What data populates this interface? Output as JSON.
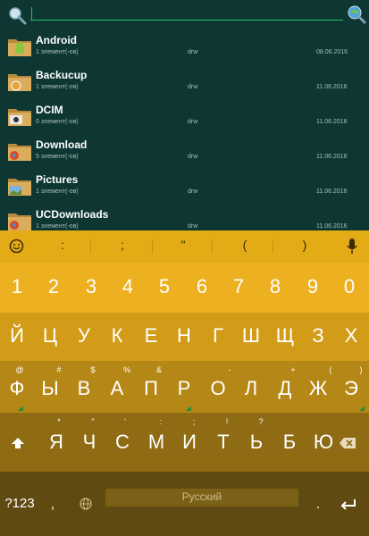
{
  "files": [
    {
      "name": "Android",
      "count": "1 элемент(-ов)",
      "perm": "drw",
      "date": "08.06.2016"
    },
    {
      "name": "Backucup",
      "count": "1 элемент(-ов)",
      "perm": "drw",
      "date": "11.06.2016"
    },
    {
      "name": "DCIM",
      "count": "0 элемент(-ов)",
      "perm": "drw",
      "date": "11.06.2016"
    },
    {
      "name": "Download",
      "count": "5 элемент(-ов)",
      "perm": "drw",
      "date": "11.06.2016"
    },
    {
      "name": "Pictures",
      "count": "1 элемент(-ов)",
      "perm": "drw",
      "date": "11.06.2016"
    },
    {
      "name": "UCDownloads",
      "count": "1 элемент(-ов)",
      "perm": "drw",
      "date": "11.06.2016"
    }
  ],
  "suggestions": [
    ":",
    ";",
    "\"",
    "(",
    ")"
  ],
  "keyboard": {
    "numbers": [
      "1",
      "2",
      "3",
      "4",
      "5",
      "6",
      "7",
      "8",
      "9",
      "0"
    ],
    "row1": [
      "Й",
      "Ц",
      "У",
      "К",
      "Е",
      "Н",
      "Г",
      "Ш",
      "Щ",
      "З",
      "Х"
    ],
    "row2": [
      "Ф",
      "Ы",
      "В",
      "А",
      "П",
      "Р",
      "О",
      "Л",
      "Д",
      "Ж",
      "Э"
    ],
    "row2_hints": [
      "@",
      "#",
      "$",
      "%",
      "&",
      "-",
      "+",
      "(",
      ")"
    ],
    "row3": [
      "Я",
      "Ч",
      "С",
      "М",
      "И",
      "Т",
      "Ь",
      "Б",
      "Ю"
    ],
    "row3_hints": [
      "*",
      "\"",
      "'",
      ":",
      ";",
      "!",
      "?"
    ],
    "symbols_key": "?123",
    "comma_key": ",",
    "space_label": "Русский",
    "period_key": "."
  },
  "colors": {
    "accent": "#1fbf6a",
    "keyboard": "#ecb020",
    "background": "#0e3733"
  }
}
